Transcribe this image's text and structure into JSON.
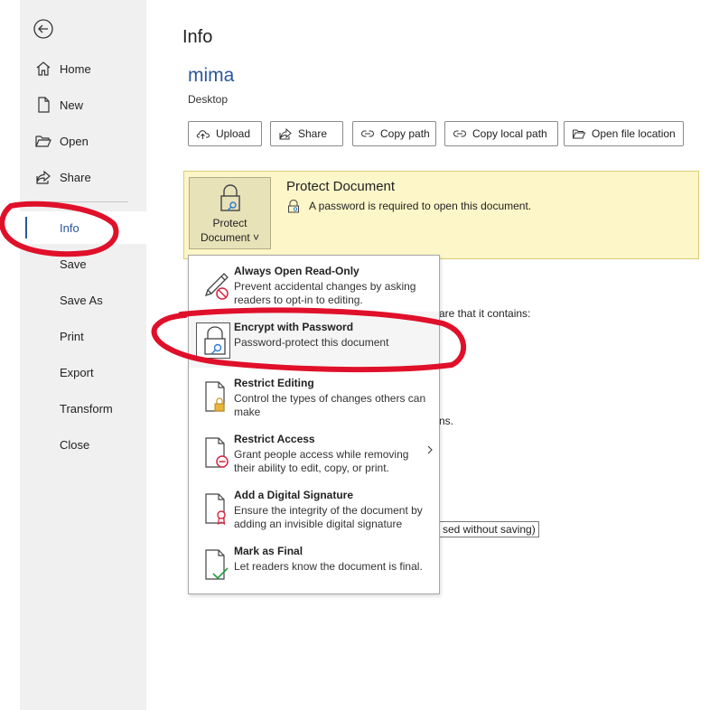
{
  "sidebar": {
    "items": [
      {
        "label": "Home",
        "icon": "home-icon"
      },
      {
        "label": "New",
        "icon": "new-document-icon"
      },
      {
        "label": "Open",
        "icon": "folder-open-icon"
      },
      {
        "label": "Share",
        "icon": "share-icon"
      },
      {
        "label": "Info"
      },
      {
        "label": "Save"
      },
      {
        "label": "Save As"
      },
      {
        "label": "Print"
      },
      {
        "label": "Export"
      },
      {
        "label": "Transform"
      },
      {
        "label": "Close"
      }
    ],
    "selected": "Info"
  },
  "main": {
    "title": "Info",
    "doc_name": "mima",
    "doc_location": "Desktop",
    "buttons": [
      {
        "label": "Upload",
        "icon": "upload-cloud-icon"
      },
      {
        "label": "Share",
        "icon": "share-icon"
      },
      {
        "label": "Copy path",
        "icon": "link-icon"
      },
      {
        "label": "Copy local path",
        "icon": "link-icon"
      },
      {
        "label": "Open file location",
        "icon": "folder-open-icon"
      }
    ]
  },
  "protect": {
    "button_line1": "Protect",
    "button_line2": "Document ˅",
    "title": "Protect Document",
    "description": "A password is required to open this document."
  },
  "background_fragments": {
    "frag1": "are that it contains:",
    "frag2": "ns.",
    "frag3": "sed without saving)"
  },
  "menu": {
    "items": [
      {
        "title": "Always Open Read-Only",
        "description": "Prevent accidental changes by asking readers to opt-in to editing.",
        "icon": "pencil-no-icon"
      },
      {
        "title": "Encrypt with Password",
        "description": "Password-protect this document",
        "icon": "lock-key-icon"
      },
      {
        "title": "Restrict Editing",
        "description": "Control the types of changes others can make",
        "icon": "document-lock-icon"
      },
      {
        "title": "Restrict Access",
        "description": "Grant people access while removing their ability to edit, copy, or print.",
        "icon": "document-restrict-icon"
      },
      {
        "title": "Add a Digital Signature",
        "description": "Ensure the integrity of the document by adding an invisible digital signature",
        "icon": "document-ribbon-icon"
      },
      {
        "title": "Mark as Final",
        "description": "Let readers know the document is final.",
        "icon": "document-check-icon"
      }
    ]
  },
  "colors": {
    "accent": "#2b579a",
    "protect_bg": "#fdf6c8",
    "annotation": "#e0102a"
  }
}
